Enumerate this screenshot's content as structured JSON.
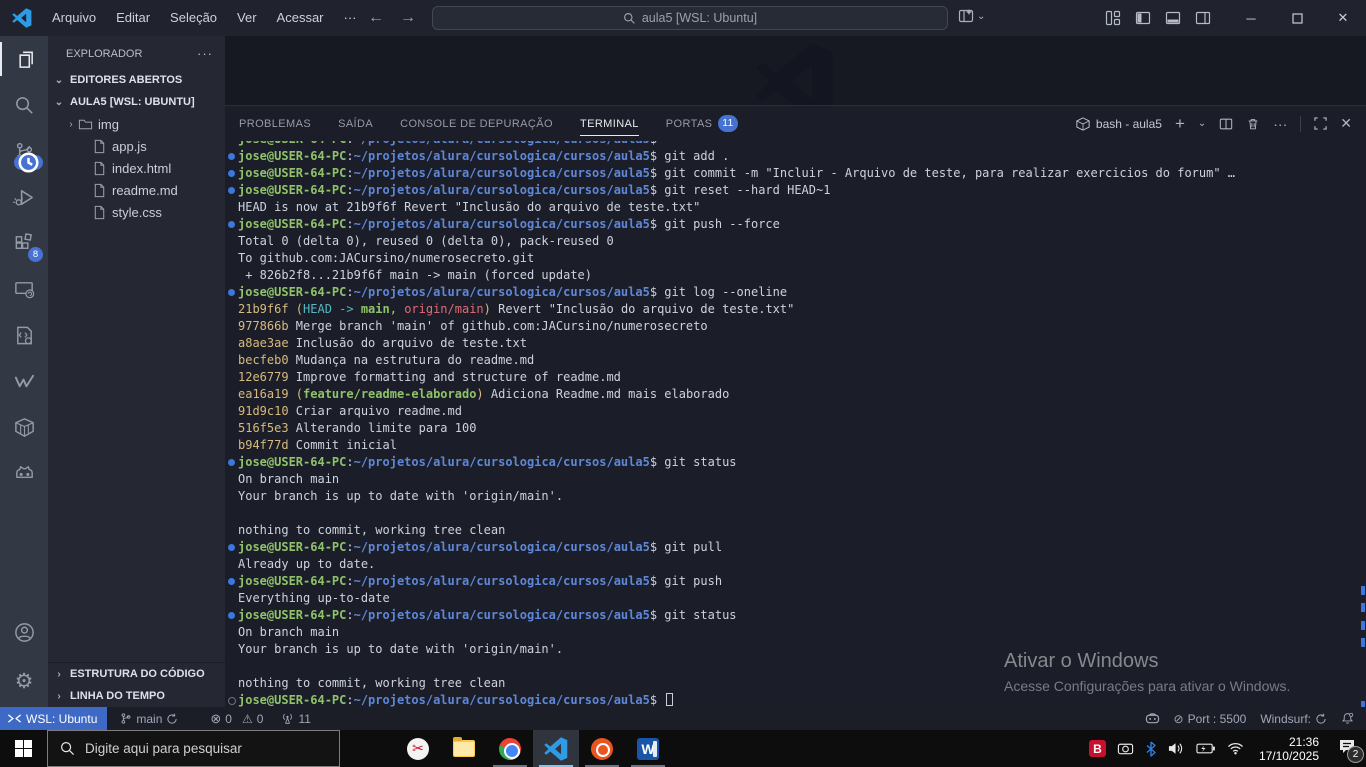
{
  "colors": {
    "accent_blue": "#3c77dd",
    "remote_blue": "#3e6ac6",
    "badge_blue": "#4673d1",
    "terminal_green": "#8fc269",
    "terminal_blue": "#5f87d8",
    "terminal_yellow": "#d7ba7d",
    "terminal_cyan": "#56b6c2",
    "terminal_red": "#e06c75",
    "terminal_fg": "#ccd2de",
    "vscode_logo_blue": "#2e9be6"
  },
  "titlebar": {
    "menus": [
      "Arquivo",
      "Editar",
      "Seleção",
      "Ver",
      "Acessar",
      "···"
    ],
    "back_icon": "←",
    "forward_icon": "→",
    "search_value": "aula5 [WSL: Ubuntu]"
  },
  "activity_bar": {
    "extensions_badge": "8"
  },
  "sidebar": {
    "title": "EXPLORADOR",
    "more": "···",
    "open_editors": "EDITORES ABERTOS",
    "workspace": "AULA5 [WSL: UBUNTU]",
    "outline": "ESTRUTURA DO CÓDIGO",
    "timeline": "LINHA DO TEMPO",
    "files": [
      {
        "label": "img",
        "type": "folder"
      },
      {
        "label": "app.js",
        "type": "file"
      },
      {
        "label": "index.html",
        "type": "file"
      },
      {
        "label": "readme.md",
        "type": "file"
      },
      {
        "label": "style.css",
        "type": "file"
      }
    ]
  },
  "panel": {
    "tabs": [
      {
        "label": "PROBLEMAS"
      },
      {
        "label": "SAÍDA"
      },
      {
        "label": "CONSOLE DE DEPURAÇÃO"
      },
      {
        "label": "TERMINAL",
        "active": true
      },
      {
        "label": "PORTAS",
        "badge": "11"
      }
    ],
    "terminal_session": "bash - aula5"
  },
  "terminal": {
    "prompt": {
      "user": "jose@USER-64-PC",
      "sep": ":",
      "path": "~/projetos/alura/cursologica/cursos/aula5",
      "symbol": "$"
    },
    "lines": [
      {
        "clip": true,
        "cmd": ""
      },
      {
        "deco": "dot",
        "cmd": "git add ."
      },
      {
        "deco": "dot",
        "cmd": "git commit -m \"Incluir - Arquivo de teste, para realizar exercicios do forum\" …"
      },
      {
        "deco": "dot",
        "cmd": "git reset --hard HEAD~1"
      },
      {
        "out": "HEAD is now at 21b9f6f Revert \"Inclusão do arquivo de teste.txt\""
      },
      {
        "deco": "dot",
        "cmd": "git push --force"
      },
      {
        "out": "Total 0 (delta 0), reused 0 (delta 0), pack-reused 0"
      },
      {
        "out": "To github.com:JACursino/numerosecreto.git"
      },
      {
        "out": " + 826b2f8...21b9f6f main -> main (forced update)"
      },
      {
        "deco": "dot",
        "cmd": "git log --oneline"
      },
      {
        "segs": [
          [
            "y",
            "21b9f6f "
          ],
          [
            "y",
            "("
          ],
          [
            "c",
            "HEAD -> "
          ],
          [
            "g",
            "main"
          ],
          [
            "y",
            ", "
          ],
          [
            "r",
            "origin/main"
          ],
          [
            "y",
            ")"
          ],
          [
            "f",
            " Revert \"Inclusão do arquivo de teste.txt\""
          ]
        ]
      },
      {
        "segs": [
          [
            "y",
            "977866b "
          ],
          [
            "f",
            "Merge branch 'main' of github.com:JACursino/numerosecreto"
          ]
        ]
      },
      {
        "segs": [
          [
            "y",
            "a8ae3ae "
          ],
          [
            "f",
            "Inclusão do arquivo de teste.txt"
          ]
        ]
      },
      {
        "segs": [
          [
            "y",
            "becfeb0 "
          ],
          [
            "f",
            "Mudança na estrutura do readme.md"
          ]
        ]
      },
      {
        "segs": [
          [
            "y",
            "12e6779 "
          ],
          [
            "f",
            "Improve formatting and structure of readme.md"
          ]
        ]
      },
      {
        "segs": [
          [
            "y",
            "ea16a19 "
          ],
          [
            "y",
            "("
          ],
          [
            "g",
            "feature/readme-elaborado"
          ],
          [
            "y",
            ")"
          ],
          [
            "f",
            " Adiciona Readme.md mais elaborado"
          ]
        ]
      },
      {
        "segs": [
          [
            "y",
            "91d9c10 "
          ],
          [
            "f",
            "Criar arquivo readme.md"
          ]
        ]
      },
      {
        "segs": [
          [
            "y",
            "516f5e3 "
          ],
          [
            "f",
            "Alterando limite para 100"
          ]
        ]
      },
      {
        "segs": [
          [
            "y",
            "b94f77d "
          ],
          [
            "f",
            "Commit inicial"
          ]
        ]
      },
      {
        "deco": "dot",
        "cmd": "git status"
      },
      {
        "out": "On branch main"
      },
      {
        "out": "Your branch is up to date with 'origin/main'."
      },
      {
        "out": ""
      },
      {
        "out": "nothing to commit, working tree clean"
      },
      {
        "deco": "dot",
        "cmd": "git pull"
      },
      {
        "out": "Already up to date."
      },
      {
        "deco": "dot",
        "cmd": "git push"
      },
      {
        "out": "Everything up-to-date"
      },
      {
        "deco": "dot",
        "cmd": "git status"
      },
      {
        "out": "On branch main"
      },
      {
        "out": "Your branch is up to date with 'origin/main'."
      },
      {
        "out": ""
      },
      {
        "out": "nothing to commit, working tree clean"
      },
      {
        "deco": "ring",
        "cmd": "",
        "cursor": true
      }
    ]
  },
  "status_bar": {
    "remote": "WSL: Ubuntu",
    "branch": "main",
    "errors": "0",
    "warnings": "0",
    "ports_count": "11",
    "port": "Port : 5500",
    "windsurf": "Windsurf:"
  },
  "activation": {
    "title": "Ativar o Windows",
    "subtitle": "Acesse Configurações para ativar o Windows."
  },
  "taskbar": {
    "search_placeholder": "Digite aqui para pesquisar",
    "tray_time": "21:36",
    "tray_date": "17/10/2025",
    "notification_count": "2"
  }
}
